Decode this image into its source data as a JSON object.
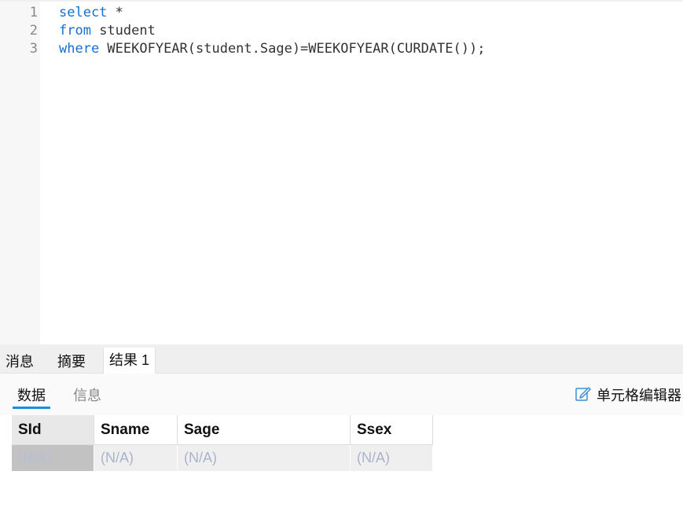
{
  "editor": {
    "lines": [
      {
        "num": "1",
        "kw": "select",
        "rest": " *"
      },
      {
        "num": "2",
        "kw": "from",
        "rest": " student"
      },
      {
        "num": "3",
        "kw": "where",
        "rest": " WEEKOFYEAR(student.Sage)=WEEKOFYEAR(CURDATE());"
      }
    ]
  },
  "tabs": [
    {
      "label": "消息",
      "active": false
    },
    {
      "label": "摘要",
      "active": false
    },
    {
      "label": "结果 1",
      "active": true
    }
  ],
  "subtabs": {
    "data_label": "数据",
    "info_label": "信息",
    "cell_editor_label": "单元格编辑器"
  },
  "grid": {
    "columns": [
      "SId",
      "Sname",
      "Sage",
      "Ssex"
    ],
    "rows": [
      [
        "(N/A)",
        "(N/A)",
        "(N/A)",
        "(N/A)"
      ]
    ]
  },
  "colors": {
    "keyword": "#1570d1",
    "accent": "#1a8fd6"
  },
  "icons": {
    "cell_editor": "pencil-edit-icon"
  }
}
